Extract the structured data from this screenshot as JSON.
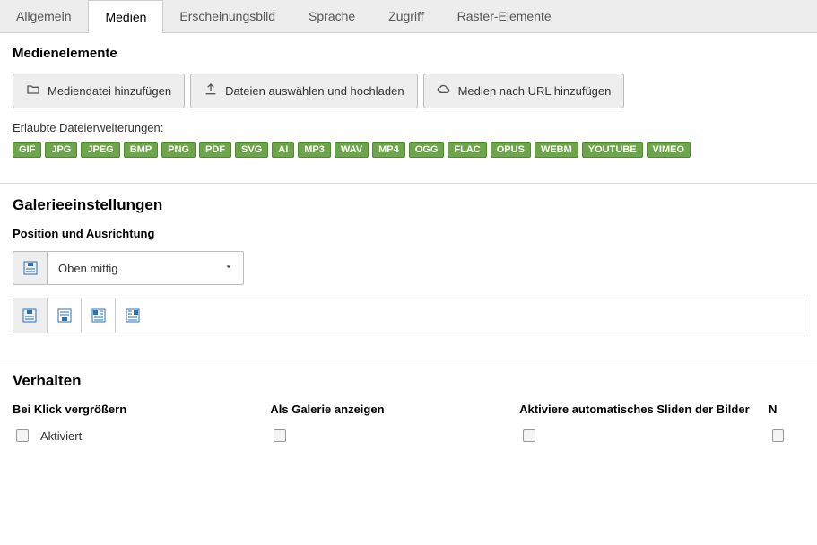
{
  "tabs": [
    "Allgemein",
    "Medien",
    "Erscheinungsbild",
    "Sprache",
    "Zugriff",
    "Raster-Elemente"
  ],
  "activeTab": 1,
  "media": {
    "title": "Medienelemente",
    "buttons": {
      "addFile": "Mediendatei hinzufügen",
      "upload": "Dateien auswählen und hochladen",
      "addUrl": "Medien nach URL hinzufügen"
    },
    "allowedLabel": "Erlaubte Dateierweiterungen:",
    "extensions": [
      "GIF",
      "JPG",
      "JPEG",
      "BMP",
      "PNG",
      "PDF",
      "SVG",
      "AI",
      "MP3",
      "WAV",
      "MP4",
      "OGG",
      "FLAC",
      "OPUS",
      "WEBM",
      "YOUTUBE",
      "VIMEO"
    ]
  },
  "gallery": {
    "title": "Galerieeinstellungen",
    "positionLabel": "Position und Ausrichtung",
    "positionValue": "Oben mittig"
  },
  "behavior": {
    "title": "Verhalten",
    "enlarge": {
      "label": "Bei Klick vergrößern",
      "checkboxLabel": "Aktiviert"
    },
    "asGallery": {
      "label": "Als Galerie anzeigen"
    },
    "autoSlide": {
      "label": "Aktiviere automatisches Sliden der Bilder"
    },
    "fourth": {
      "label": "N"
    }
  }
}
